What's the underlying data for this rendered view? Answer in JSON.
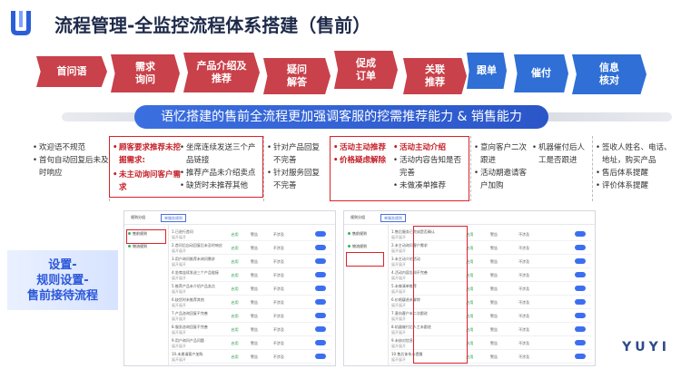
{
  "header": {
    "logo": "u-logo-icon",
    "title": "流程管理-全监控流程体系搭建（售前）"
  },
  "steps": [
    {
      "label": "首问语",
      "color": "red"
    },
    {
      "label": "需求\n询问",
      "color": "red"
    },
    {
      "label": "产品介绍及\n推荐",
      "color": "red"
    },
    {
      "label": "疑问\n解答",
      "color": "red"
    },
    {
      "label": "促成\n订单",
      "color": "red"
    },
    {
      "label": "关联\n推荐",
      "color": "red"
    },
    {
      "label": "跟单",
      "color": "blue"
    },
    {
      "label": "催付",
      "color": "blue"
    },
    {
      "label": "信息\n核对",
      "color": "blue"
    }
  ],
  "banner": "语忆搭建的售前全流程更加强调客服的挖需推荐能力 & 销售能力",
  "columns": {
    "c1": [
      "欢迎语不规范",
      "首句自动回复后未及时响应"
    ],
    "c2": [
      "顾客要求推荐未挖掘需求:",
      "未主动询问客户需求"
    ],
    "c3": [
      "坐席连续发送三个产品链接",
      "推荐产品未介绍卖点",
      "缺货时未推荐其他"
    ],
    "c4": [
      "针对产品回复不完善",
      "针对服务回复不完善"
    ],
    "c5": [
      "活动主动推荐",
      "价格疑虑解除"
    ],
    "c6": [
      "活动主动介绍",
      "活动内容告知是否完善",
      "未做凑单推荐"
    ],
    "c7": [
      "意向客户二次跟进",
      "活动期邀请客户加购"
    ],
    "c8": [
      "机器催付后人工是否跟进"
    ],
    "c9": [
      "签收人姓名、电话、地址，购买产品",
      "售后体系提醒",
      "评价体系提醒"
    ]
  },
  "side_label": [
    "设置-",
    "规则设置-",
    "售前接待流程"
  ],
  "shot_left": {
    "tabs": [
      "规则分组",
      "单服务规则"
    ],
    "side_items": [
      "售前规则",
      "物流规则"
    ],
    "rows": [
      {
        "name": "1.已进行首问",
        "sub": "展开展开",
        "status": "启用",
        "level": "警告",
        "type": "不涉及"
      },
      {
        "name": "2.首问后自动回复后未及时响应",
        "sub": "展开展开",
        "status": "启用",
        "level": "警告",
        "type": "不涉及"
      },
      {
        "name": "3.用户询问推荐未询问需求",
        "sub": "展开展开",
        "status": "启用",
        "level": "警告",
        "type": "不涉及"
      },
      {
        "name": "4.坐席连续发送三个产品链接",
        "sub": "展开展开",
        "status": "启用",
        "level": "警告",
        "type": "不涉及"
      },
      {
        "name": "5.推荐产品未介绍产品卖点",
        "sub": "展开展开",
        "status": "启用",
        "level": "警告",
        "type": "不涉及"
      },
      {
        "name": "6.缺货时未推荐其他",
        "sub": "展开展开",
        "status": "启用",
        "level": "警告",
        "type": "不涉及"
      },
      {
        "name": "7.产品咨询回复不完善",
        "sub": "展开展开",
        "status": "启用",
        "level": "警告",
        "type": "不涉及"
      },
      {
        "name": "8.服务咨询回复不完善",
        "sub": "展开展开",
        "status": "启用",
        "level": "警告",
        "type": "不涉及"
      },
      {
        "name": "9.用户询问产品问题",
        "sub": "展开展开",
        "status": "启用",
        "level": "警告",
        "type": "不涉及"
      },
      {
        "name": "10.未邀请客户加购",
        "sub": "展开展开",
        "status": "启用",
        "level": "警告",
        "type": "不涉及"
      }
    ]
  },
  "shot_right": {
    "tabs": [
      "规则分组",
      "单服务规则"
    ],
    "side_items": [
      "售前规则",
      "物流规则"
    ],
    "rows": [
      {
        "name": "1.售后服务已完成是否确认",
        "sub": "展开展开",
        "status": "启用",
        "level": "警告",
        "type": "不涉及"
      },
      {
        "name": "2.未主动询问客户需求",
        "sub": "展开展开",
        "status": "启用",
        "level": "警告",
        "type": "不涉及"
      },
      {
        "name": "3.未主动介绍活动",
        "sub": "展开展开",
        "status": "启用",
        "level": "警告",
        "type": "不涉及"
      },
      {
        "name": "4.活动内容告知不完善",
        "sub": "展开展开",
        "status": "启用",
        "level": "警告",
        "type": "不涉及"
      },
      {
        "name": "5.未做凑单推荐",
        "sub": "展开展开",
        "status": "启用",
        "level": "警告",
        "type": "不涉及"
      },
      {
        "name": "6.价格疑虑未解除",
        "sub": "展开展开",
        "status": "启用",
        "level": "警告",
        "type": "不涉及"
      },
      {
        "name": "7.意向客户未二次跟进",
        "sub": "展开展开",
        "status": "启用",
        "level": "警告",
        "type": "不涉及"
      },
      {
        "name": "8.机器催付后人工未跟进",
        "sub": "展开展开",
        "status": "启用",
        "level": "警告",
        "type": "不涉及"
      },
      {
        "name": "9.未核对信息",
        "sub": "展开展开",
        "status": "启用",
        "level": "警告",
        "type": "不涉及"
      },
      {
        "name": "10.售后体系未提醒",
        "sub": "展开展开",
        "status": "启用",
        "level": "警告",
        "type": "不涉及"
      }
    ]
  },
  "watermark": "YUYI"
}
